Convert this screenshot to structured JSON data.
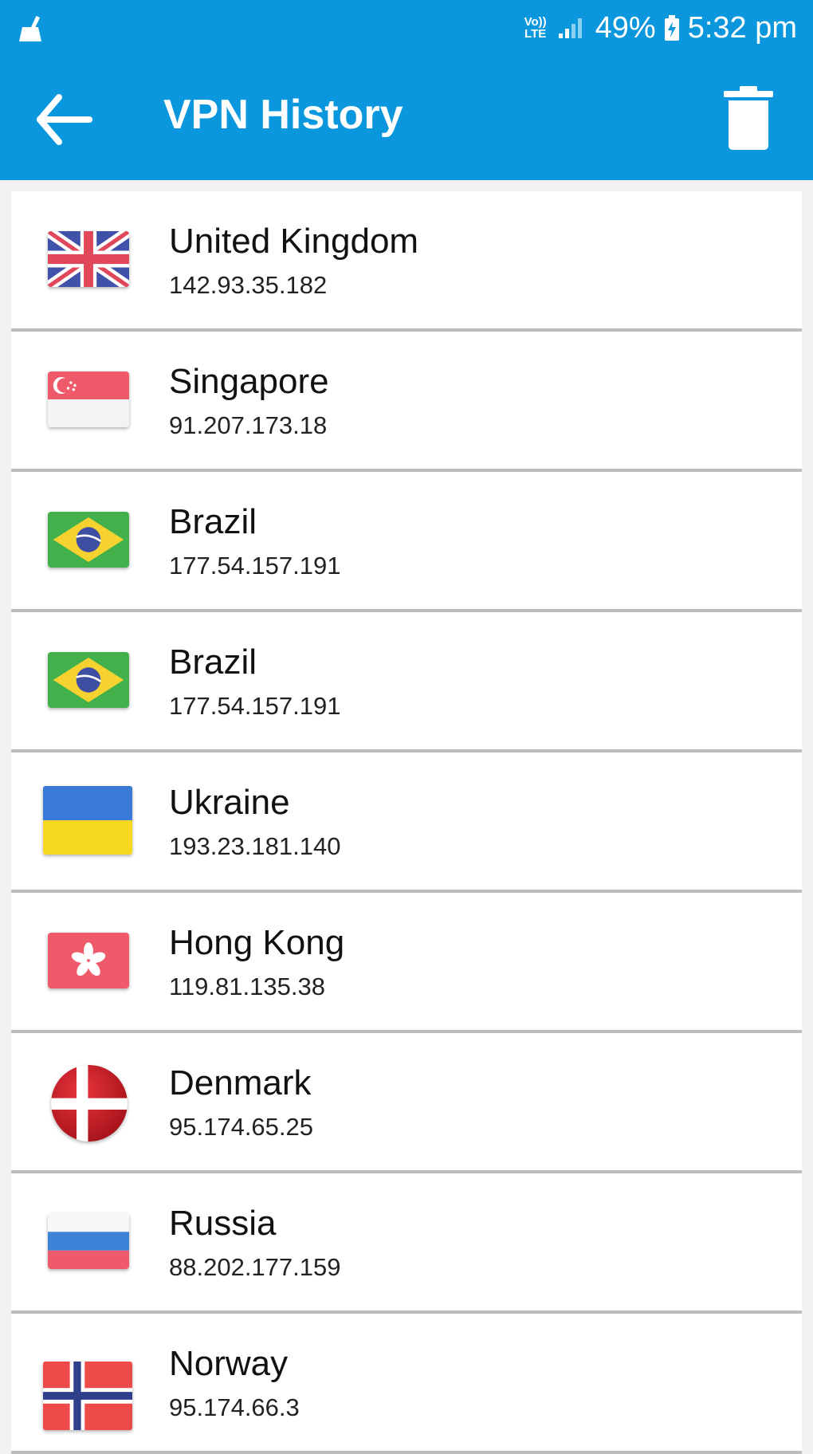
{
  "status_bar": {
    "volte_top": "Vo))",
    "volte_bottom": "LTE",
    "battery": "49%",
    "time": "5:32 pm"
  },
  "app_bar": {
    "title": "VPN History",
    "back_icon": "arrow-back-icon",
    "delete_icon": "trash-icon"
  },
  "history": [
    {
      "country": "United Kingdom",
      "ip": "142.93.35.182",
      "flag": "gb"
    },
    {
      "country": "Singapore",
      "ip": "91.207.173.18",
      "flag": "sg"
    },
    {
      "country": "Brazil",
      "ip": "177.54.157.191",
      "flag": "br"
    },
    {
      "country": "Brazil",
      "ip": "177.54.157.191",
      "flag": "br"
    },
    {
      "country": "Ukraine",
      "ip": "193.23.181.140",
      "flag": "ua"
    },
    {
      "country": "Hong Kong",
      "ip": "119.81.135.38",
      "flag": "hk"
    },
    {
      "country": "Denmark",
      "ip": "95.174.65.25",
      "flag": "dk"
    },
    {
      "country": "Russia",
      "ip": "88.202.177.159",
      "flag": "ru"
    },
    {
      "country": "Norway",
      "ip": "95.174.66.3",
      "flag": "no"
    }
  ],
  "colors": {
    "primary": "#0a97de",
    "divider": "#bcbcbc"
  }
}
